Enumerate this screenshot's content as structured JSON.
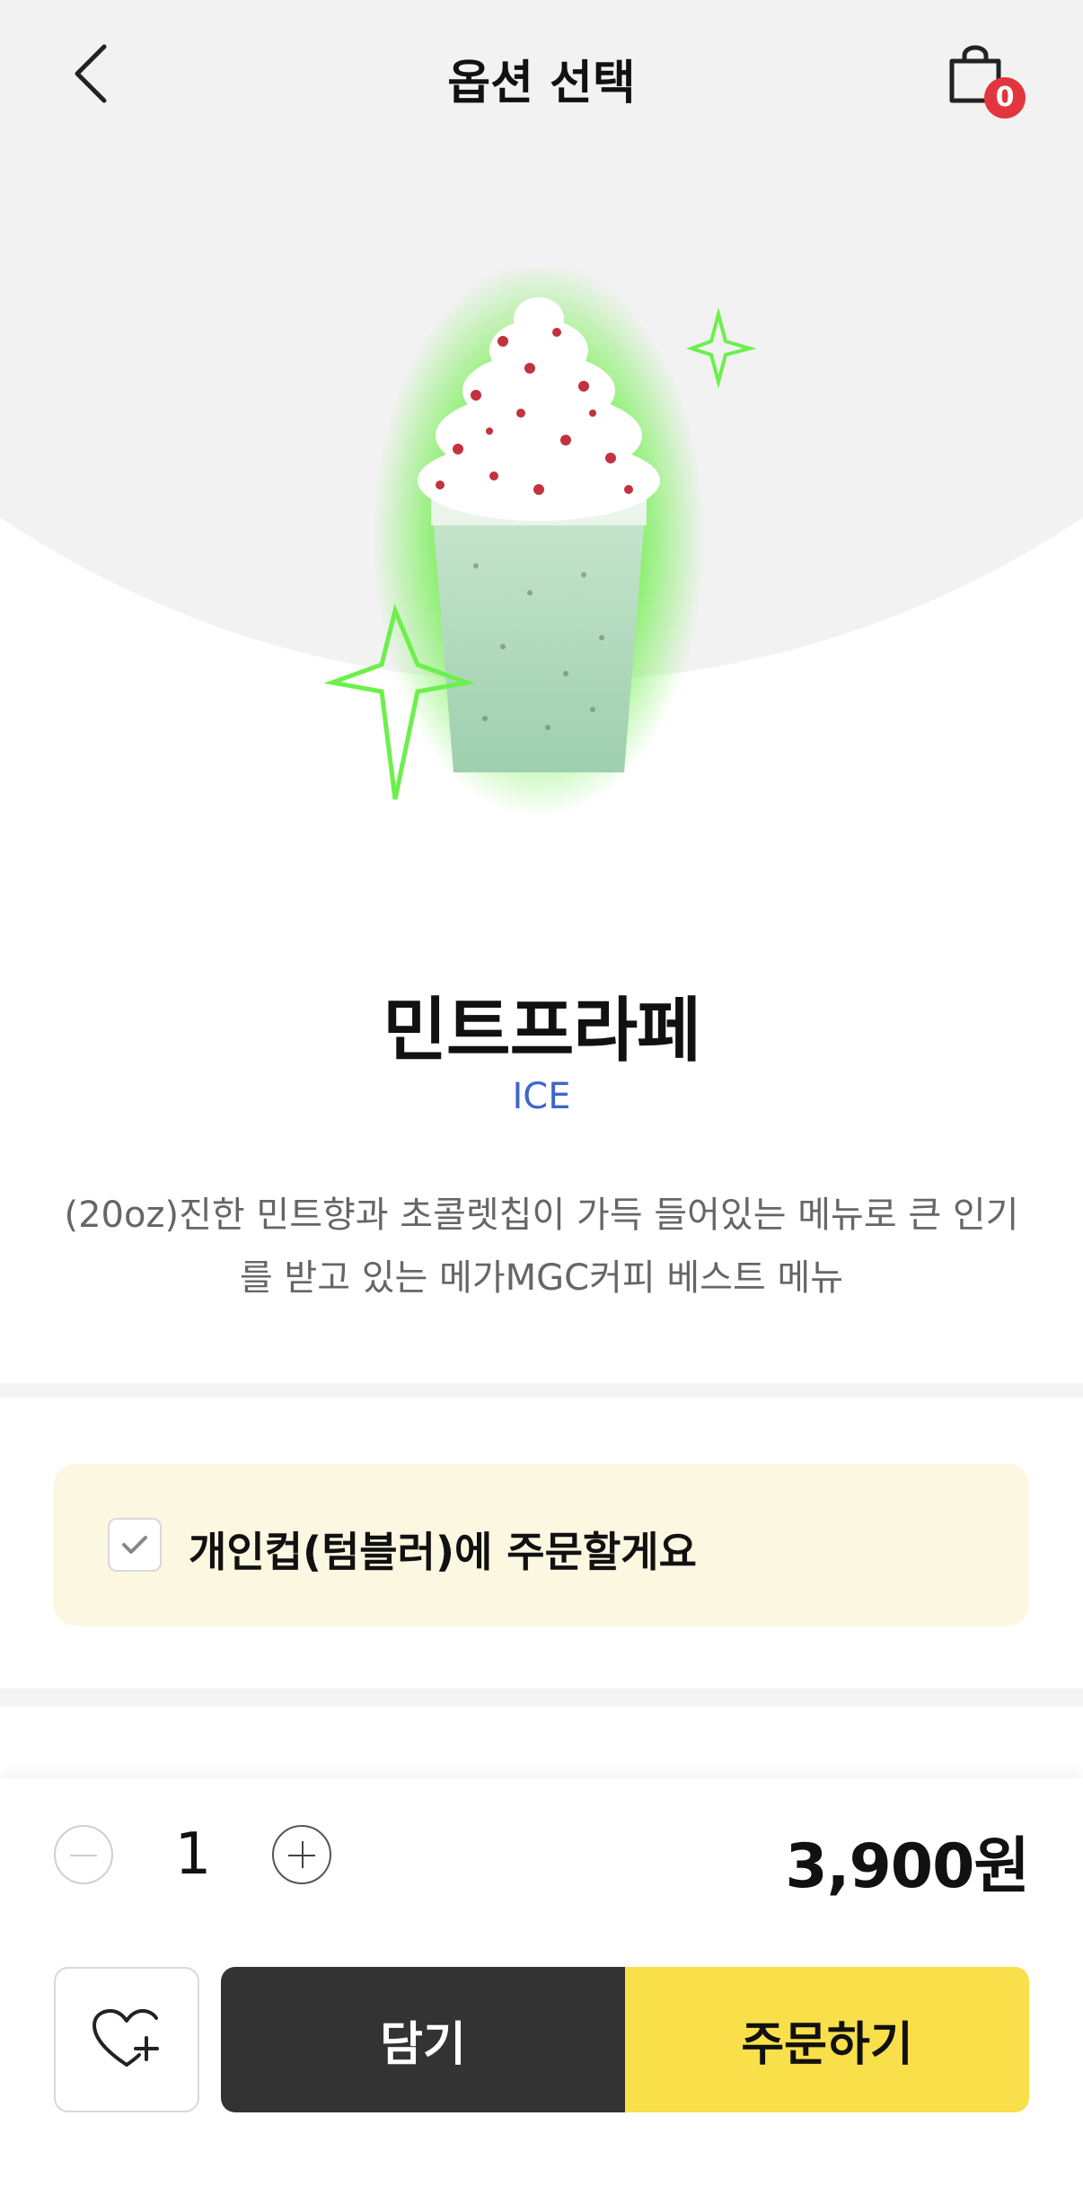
{
  "header": {
    "title": "옵션 선택",
    "cart_count": "0"
  },
  "product": {
    "name": "민트프라페",
    "temperature": "ICE",
    "description": "(20oz)진한 민트향과 초콜렛칩이 가득 들어있는 메뉴로 큰 인기를 받고 있는 메가MGC커피 베스트 메뉴"
  },
  "options": {
    "tumbler_label": "개인컵(텀블러)에 주문할게요"
  },
  "order": {
    "quantity": "1",
    "price": "3,900원",
    "cart_button": "담기",
    "order_button": "주문하기"
  },
  "colors": {
    "accent_yellow": "#f9df4a",
    "dark_button": "#333333",
    "badge_red": "#e2363f",
    "ice_blue": "#3f66c9",
    "option_bg": "#fbf7e1"
  },
  "icons": {
    "back": "chevron-left-icon",
    "cart": "shopping-bag-icon",
    "favorite": "heart-plus-icon",
    "check": "check-icon"
  }
}
